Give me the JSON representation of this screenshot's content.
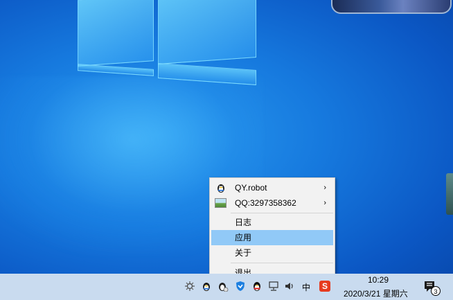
{
  "menu": {
    "items": [
      {
        "label": "QY.robot",
        "icon": "qq-penguin-icon",
        "submenu": true
      },
      {
        "label": "QQ:3297358362",
        "icon": "landscape-picture-icon",
        "submenu": true
      },
      {
        "label": "日志"
      },
      {
        "label": "应用",
        "highlighted": true
      },
      {
        "label": "关于"
      },
      {
        "label": "退出"
      }
    ],
    "submenu_arrow": "›",
    "highlight_color": "#91c9f7"
  },
  "taskbar": {
    "time": "10:29",
    "date": "2020/3/21 星期六",
    "notification_count": "3",
    "tray_icons": [
      "bug-icon",
      "qq-robot-icon",
      "penguin-app-icon",
      "shield-icon",
      "qq-icon",
      "network-icon",
      "volume-icon",
      "ime-icon",
      "sogou-ime-icon"
    ],
    "ime_label": "中",
    "sogou_label": "S"
  },
  "colors": {
    "desktop_blue": "#1679de",
    "taskbar": "#c9dbef"
  }
}
